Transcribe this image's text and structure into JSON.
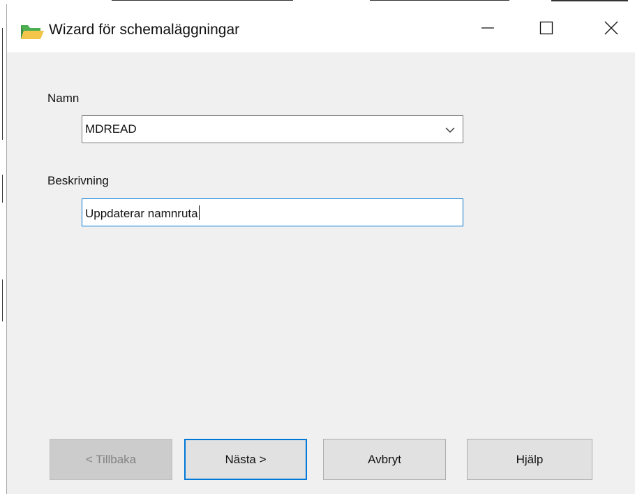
{
  "window": {
    "title": "Wizard för schemaläggningar",
    "controls": {
      "minimize_icon": "minimize-icon",
      "maximize_icon": "maximize-icon",
      "close_icon": "close-icon"
    }
  },
  "form": {
    "name_label": "Namn",
    "name_value": "MDREAD",
    "description_label": "Beskrivning",
    "description_value": "Uppdaterar namnruta"
  },
  "buttons": {
    "back": "< Tillbaka",
    "next": "Nästa >",
    "cancel": "Avbryt",
    "help": "Hjälp"
  },
  "colors": {
    "focus_accent": "#0078d7",
    "window_bg": "#f0f0f0",
    "button_bg": "#e1e1e1",
    "disabled_button_bg": "#cccccc",
    "folder_icon": "#f3c64b"
  }
}
